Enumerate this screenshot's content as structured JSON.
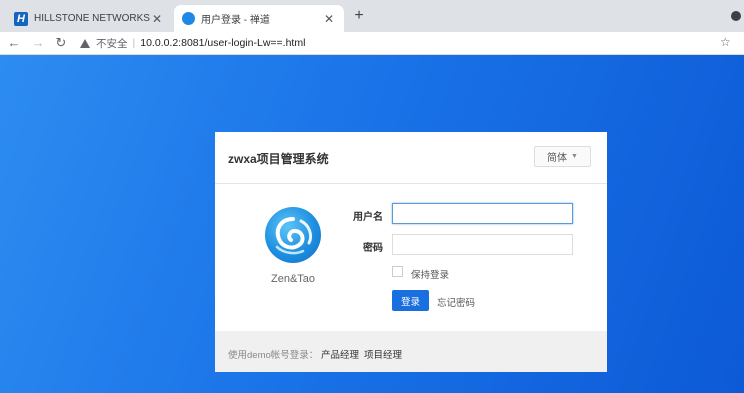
{
  "browser": {
    "tabs": [
      {
        "title": "HILLSTONE NETWORKS",
        "favicon": "H"
      },
      {
        "title": "用户登录 - 禅道",
        "active": true
      }
    ],
    "security_label": "不安全",
    "url": "10.0.0.2:8081/user-login-Lw==.html"
  },
  "login": {
    "title": "zwxa项目管理系统",
    "language": "简体",
    "logo_text": "Zen&Tao",
    "username_label": "用户名",
    "password_label": "密码",
    "username_value": "",
    "password_value": "",
    "remember_label": "保持登录",
    "remember_checked": false,
    "submit_label": "登录",
    "forgot_label": "忘记密码",
    "demo_text": "使用demo帐号登录：",
    "demo_links": [
      "产品经理",
      "项目经理"
    ]
  },
  "colors": {
    "background_start": "#2d8cf0",
    "background_end": "#0d5ad6",
    "button": "#1a6fe0"
  }
}
